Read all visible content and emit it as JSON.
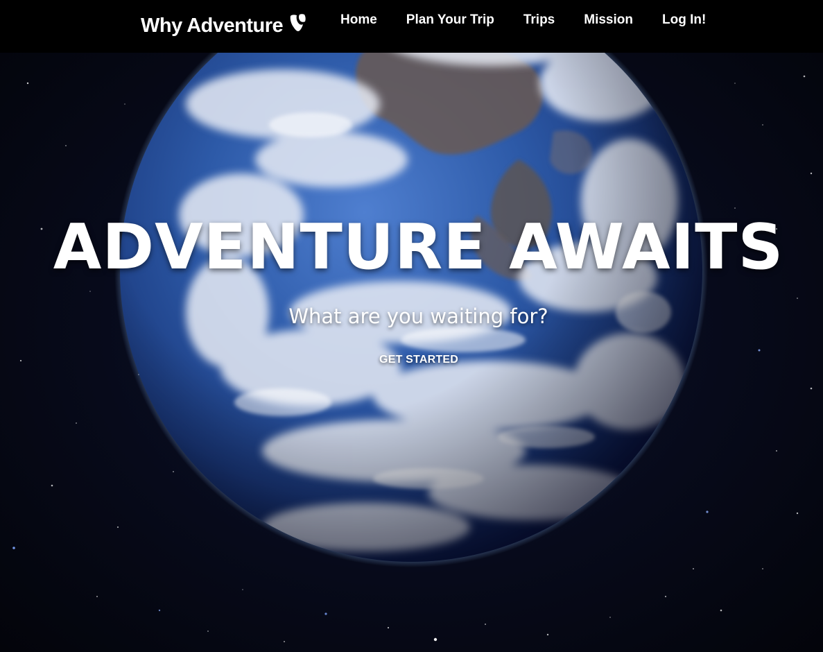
{
  "navbar": {
    "brand": "Why Adventure",
    "brand_icon": "typo3-logo-icon",
    "links": [
      {
        "label": "Home"
      },
      {
        "label": "Plan Your Trip"
      },
      {
        "label": "Trips"
      },
      {
        "label": "Mission"
      },
      {
        "label": "Log In!"
      }
    ]
  },
  "hero": {
    "title": "ADVENTURE AWAITS",
    "subtitle": "What are you waiting for?",
    "cta_label": "GET STARTED",
    "background_image": "earth-from-space-image"
  },
  "colors": {
    "navbar_bg": "#000000",
    "text": "#ffffff",
    "space": "#070a1a",
    "ocean": "#2a5cae"
  }
}
